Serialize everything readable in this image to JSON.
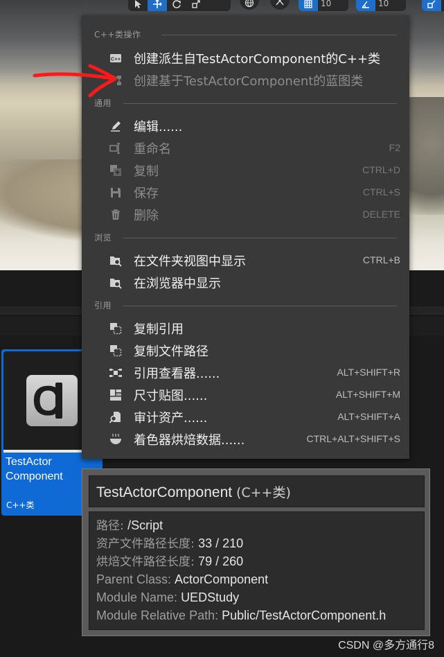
{
  "viewport_toolbar": {
    "snap_grid_value": "10",
    "snap_angle_value": "10"
  },
  "context_menu": {
    "sections": {
      "cpp": "C++类操作",
      "general": "通用",
      "browse": "浏览",
      "reference": "引用"
    },
    "items": {
      "create_derived_cpp": {
        "label": "创建派生自TestActorComponent的C++类",
        "shortcut": ""
      },
      "create_blueprint": {
        "label": "创建基于TestActorComponent的蓝图类",
        "shortcut": ""
      },
      "edit": {
        "label": "编辑......",
        "shortcut": ""
      },
      "rename": {
        "label": "重命名",
        "shortcut": "F2"
      },
      "duplicate": {
        "label": "复制",
        "shortcut": "CTRL+D"
      },
      "save": {
        "label": "保存",
        "shortcut": "CTRL+S"
      },
      "delete": {
        "label": "删除",
        "shortcut": "DELETE"
      },
      "show_in_folder_view": {
        "label": "在文件夹视图中显示",
        "shortcut": "CTRL+B"
      },
      "show_in_explorer": {
        "label": "在浏览器中显示",
        "shortcut": ""
      },
      "copy_reference": {
        "label": "复制引用",
        "shortcut": ""
      },
      "copy_file_path": {
        "label": "复制文件路径",
        "shortcut": ""
      },
      "reference_viewer": {
        "label": "引用查看器......",
        "shortcut": "ALT+SHIFT+R"
      },
      "size_map": {
        "label": "尺寸贴图......",
        "shortcut": "ALT+SHIFT+M"
      },
      "audit_assets": {
        "label": "审计资产......",
        "shortcut": "ALT+SHIFT+A"
      },
      "shader_cook_data": {
        "label": "着色器烘焙数据......",
        "shortcut": "CTRL+ALT+SHIFT+S"
      }
    }
  },
  "asset_tile": {
    "name_line1": "TestActor",
    "name_line2": "Component",
    "type": "C++类",
    "icon_glyph": "C"
  },
  "tooltip": {
    "title": "TestActorComponent",
    "type": "(C++类)",
    "rows": [
      {
        "key": "路径: ",
        "value": "/Script"
      },
      {
        "key": "资产文件路径长度: ",
        "value": "33 / 210"
      },
      {
        "key": "烘焙文件路径长度: ",
        "value": "79 / 260"
      },
      {
        "key": "Parent Class: ",
        "value": "ActorComponent"
      },
      {
        "key": "Module Name: ",
        "value": "UEDStudy"
      },
      {
        "key": "Module Relative Path: ",
        "value": "Public/TestActorComponent.h"
      }
    ]
  },
  "watermark": "CSDN @多方通行8",
  "colors": {
    "menu_bg": "#393939",
    "selection_blue": "#0f6ad6",
    "annotation_red": "#ff1a1a"
  }
}
